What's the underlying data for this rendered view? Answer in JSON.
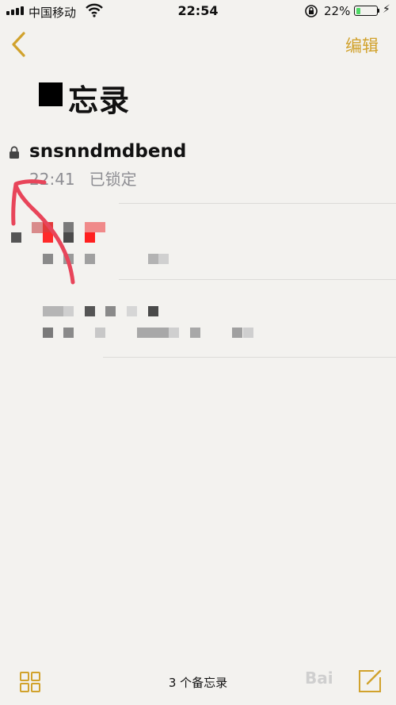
{
  "status_bar": {
    "carrier": "中国移动",
    "time": "22:54",
    "battery_percent": "22%",
    "battery_level": 0.22
  },
  "nav": {
    "back_icon": "chevron-left-icon",
    "edit_label": "编辑"
  },
  "page": {
    "title": "忘录"
  },
  "notes": [
    {
      "title": "snsnndmdbend",
      "time": "22:41",
      "status": "已锁定",
      "locked": true
    }
  ],
  "footer": {
    "count_label": "3 个备忘录"
  },
  "watermark": {
    "text": "Bai"
  },
  "colors": {
    "accent": "#d1a22c",
    "annotation": "#e8455a",
    "battery": "#4cd964"
  }
}
